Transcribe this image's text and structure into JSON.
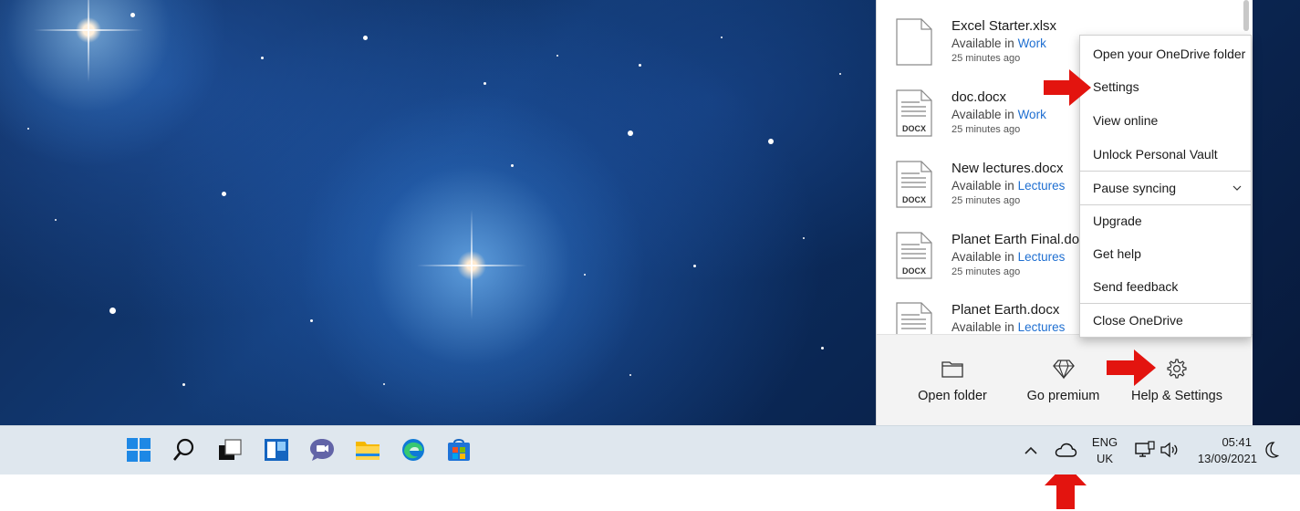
{
  "files": [
    {
      "name": "Excel Starter.xlsx",
      "available_prefix": "Available in ",
      "location": "Work",
      "time": "25 minutes ago",
      "icon": "blank-file-icon"
    },
    {
      "name": "doc.docx",
      "available_prefix": "Available in ",
      "location": "Work",
      "time": "25 minutes ago",
      "icon": "docx-file-icon",
      "badge": "DOCX"
    },
    {
      "name": "New lectures.docx",
      "available_prefix": "Available in ",
      "location": "Lectures",
      "time": "25 minutes ago",
      "icon": "docx-file-icon",
      "badge": "DOCX"
    },
    {
      "name": "Planet Earth Final.doc",
      "available_prefix": "Available in ",
      "location": "Lectures",
      "time": "25 minutes ago",
      "icon": "docx-file-icon",
      "badge": "DOCX"
    },
    {
      "name": "Planet Earth.docx",
      "available_prefix": "Available in ",
      "location": "Lectures",
      "time": "",
      "icon": "docx-file-icon",
      "badge": ""
    }
  ],
  "menu": {
    "items": [
      {
        "label": "Open your OneDrive folder"
      },
      {
        "label": "Settings"
      },
      {
        "label": "View online"
      },
      {
        "label": "Unlock Personal Vault"
      },
      {
        "label": "Pause syncing"
      },
      {
        "label": "Upgrade"
      },
      {
        "label": "Get help"
      },
      {
        "label": "Send feedback"
      },
      {
        "label": "Close OneDrive"
      }
    ]
  },
  "footer": {
    "open_folder": "Open folder",
    "go_premium": "Go premium",
    "help_settings": "Help & Settings"
  },
  "taskbar": {
    "icons": [
      "windows-start-icon",
      "search-icon",
      "task-view-icon",
      "widgets-icon",
      "teams-chat-icon",
      "file-explorer-icon",
      "edge-icon",
      "store-icon"
    ],
    "language_line1": "ENG",
    "language_line2": "UK",
    "time": "05:41",
    "date": "13/09/2021"
  },
  "colors": {
    "link_blue": "#1f6fd1",
    "arrow_red": "#e3140f",
    "taskbar_bg": "#dfe7ee",
    "panel_footer_bg": "#f3f3f3"
  }
}
